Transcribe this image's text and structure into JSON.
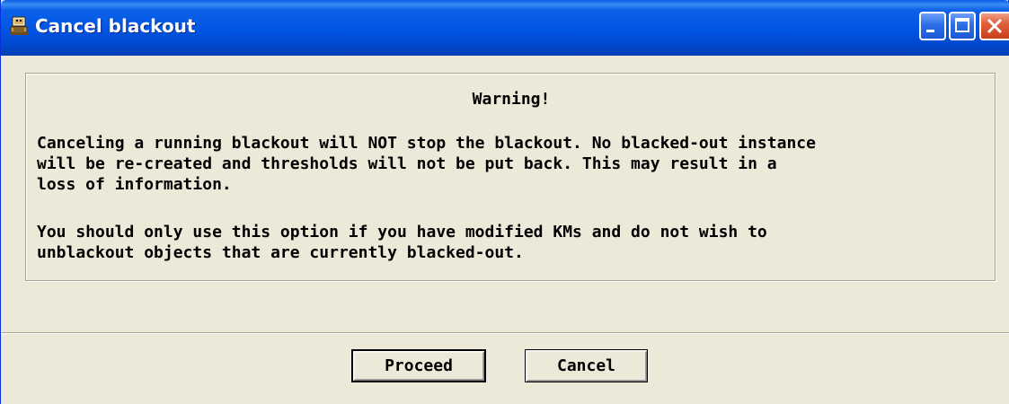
{
  "window": {
    "title": "Cancel blackout",
    "icon": "blackout-app-icon",
    "controls": [
      "minimize-icon",
      "maximize-icon",
      "close-icon"
    ]
  },
  "message": {
    "heading": "Warning!",
    "paragraph1": "Canceling a running blackout will NOT stop the blackout. No blacked-out instance\nwill be re-created and thresholds will not be put back. This may result in a\nloss of information.",
    "paragraph2": "You should only use this option if you have modified KMs and do not wish to\nunblackout objects that are currently blacked-out."
  },
  "buttons": {
    "proceed_label": "Proceed",
    "cancel_label": "Cancel"
  },
  "colors": {
    "titlebar": "#0054e3",
    "dialog_bg": "#ece9d8",
    "close_button": "#e0603c"
  }
}
